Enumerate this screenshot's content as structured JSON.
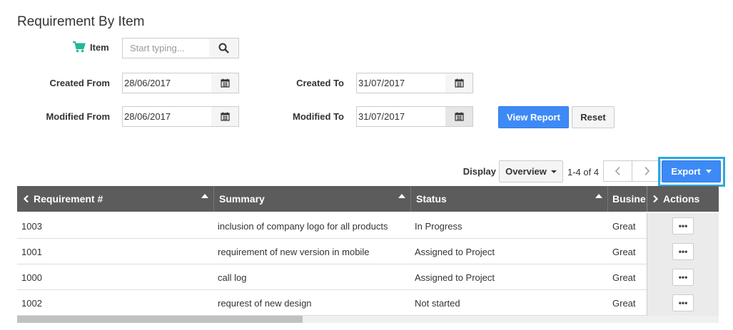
{
  "page": {
    "title": "Requirement By Item"
  },
  "filters": {
    "item_label": "Item",
    "item_placeholder": "Start typing...",
    "created_from_label": "Created From",
    "created_from_value": "28/06/2017",
    "created_to_label": "Created To",
    "created_to_value": "31/07/2017",
    "modified_from_label": "Modified From",
    "modified_from_value": "28/06/2017",
    "modified_to_label": "Modified To",
    "modified_to_value": "31/07/2017",
    "view_report_label": "View Report",
    "reset_label": "Reset"
  },
  "toolbar": {
    "display_label": "Display",
    "display_value": "Overview",
    "page_info": "1-4 of 4",
    "export_label": "Export"
  },
  "table": {
    "columns": [
      "Requirement #",
      "Summary",
      "Status",
      "Busine",
      "Actions"
    ],
    "rows": [
      {
        "id": "1003",
        "summary": "inclusion of company logo for all products",
        "status": "In Progress",
        "business": "Great"
      },
      {
        "id": "1001",
        "summary": "requirement of new version in mobile",
        "status": "Assigned to Project",
        "business": "Great"
      },
      {
        "id": "1000",
        "summary": "call log",
        "status": "Assigned to Project",
        "business": "Great"
      },
      {
        "id": "1002",
        "summary": "requrest of new design",
        "status": "Not started",
        "business": "Great"
      }
    ],
    "row_action_label": "•••"
  },
  "colors": {
    "primary": "#3d8af7",
    "header_bg": "#5c5c5c",
    "cart_icon": "#1fb89a",
    "export_highlight": "#29a9e0"
  }
}
